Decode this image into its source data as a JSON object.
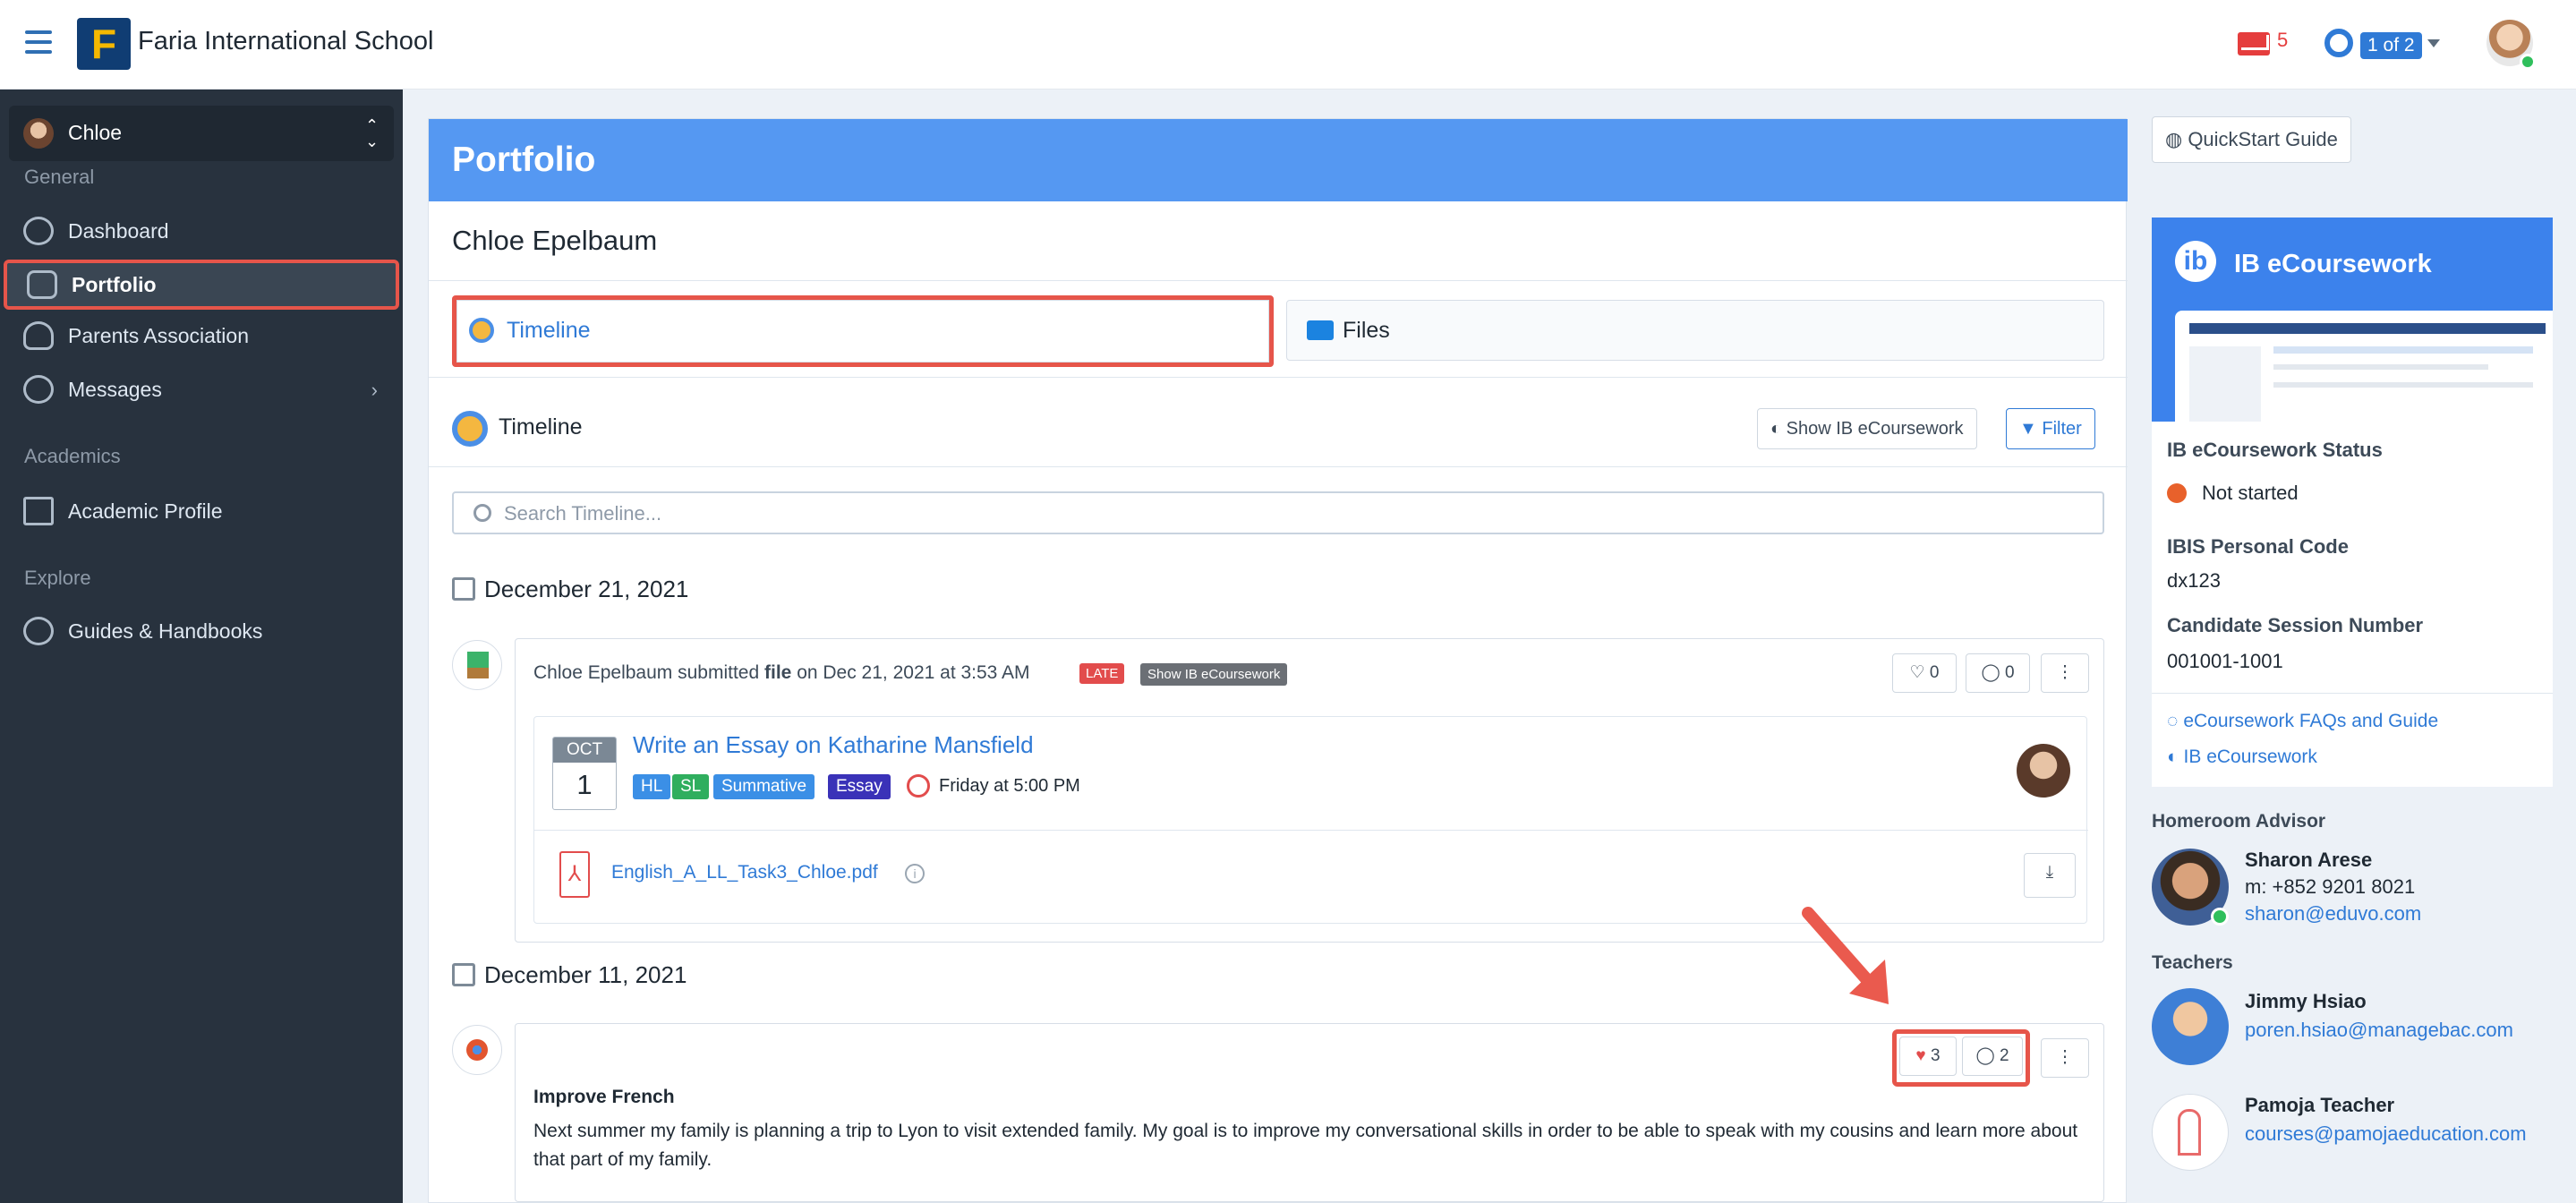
{
  "app": {
    "school_name": "Faria International School",
    "logo_letter": "F",
    "mail_count": "5",
    "pager": "1 of 2"
  },
  "colors": {
    "accent": "#2f7ad6",
    "sidebar": "#28323e",
    "header": "#5598f2",
    "annotation": "#e6554a",
    "late": "#e24c4c"
  },
  "sidebar": {
    "user": "Chloe",
    "sections": {
      "general": "General",
      "academics": "Academics",
      "explore": "Explore"
    },
    "items": [
      {
        "label": "Dashboard",
        "icon": "dashboard-icon"
      },
      {
        "label": "Portfolio",
        "icon": "briefcase-icon"
      },
      {
        "label": "Parents Association",
        "icon": "people-icon"
      },
      {
        "label": "Messages",
        "icon": "chat-icon"
      },
      {
        "label": "Academic Profile",
        "icon": "document-icon"
      },
      {
        "label": "Guides & Handbooks",
        "icon": "group-icon"
      }
    ]
  },
  "main": {
    "title": "Portfolio",
    "student": "Chloe Epelbaum",
    "tabs": [
      {
        "label": "Timeline"
      },
      {
        "label": "Files"
      }
    ],
    "timeline_title": "Timeline",
    "show_ib_button": "Show IB eCoursework",
    "filter_button": "Filter",
    "search_placeholder": "Search Timeline...",
    "entries": [
      {
        "date": "December 21, 2021",
        "author": "Chloe Epelbaum",
        "verb": "submitted",
        "object": "file",
        "when": "on Dec 21, 2021 at 3:53 AM",
        "late_badge": "LATE",
        "ib_badge": "Show IB eCoursework",
        "likes": "0",
        "comments": "0",
        "task": {
          "month": "OCT",
          "day": "1",
          "title": "Write an Essay on Katharine Mansfield",
          "tags": [
            "HL",
            "SL",
            "Summative",
            "Essay"
          ],
          "due": "Friday at 5:00 PM"
        },
        "file": "English_A_LL_Task3_Chloe.pdf"
      },
      {
        "date": "December 11, 2021",
        "heading": "Improve French",
        "likes": "3",
        "comments": "2",
        "body": "Next summer my family is planning a trip to Lyon to visit extended family. My goal is to improve my conversational skills in order to be able to speak with my cousins and learn more about that part of my family."
      }
    ]
  },
  "right": {
    "quickstart": "QuickStart Guide",
    "ib_banner": "IB eCoursework",
    "status_label": "IB eCoursework Status",
    "status_value": "Not started",
    "code_label": "IBIS Personal Code",
    "code_value": "dx123",
    "session_label": "Candidate Session Number",
    "session_value": "001001-1001",
    "faq_link": "eCoursework FAQs and Guide",
    "ib_link": "IB eCoursework",
    "homeroom_label": "Homeroom Advisor",
    "advisor": {
      "name": "Sharon Arese",
      "phone": "m: +852 9201 8021",
      "email": "sharon@eduvo.com"
    },
    "teachers_label": "Teachers",
    "teachers": [
      {
        "name": "Jimmy Hsiao",
        "email": "poren.hsiao@managebac.com"
      },
      {
        "name": "Pamoja Teacher",
        "email": "courses@pamojaeducation.com"
      }
    ]
  }
}
